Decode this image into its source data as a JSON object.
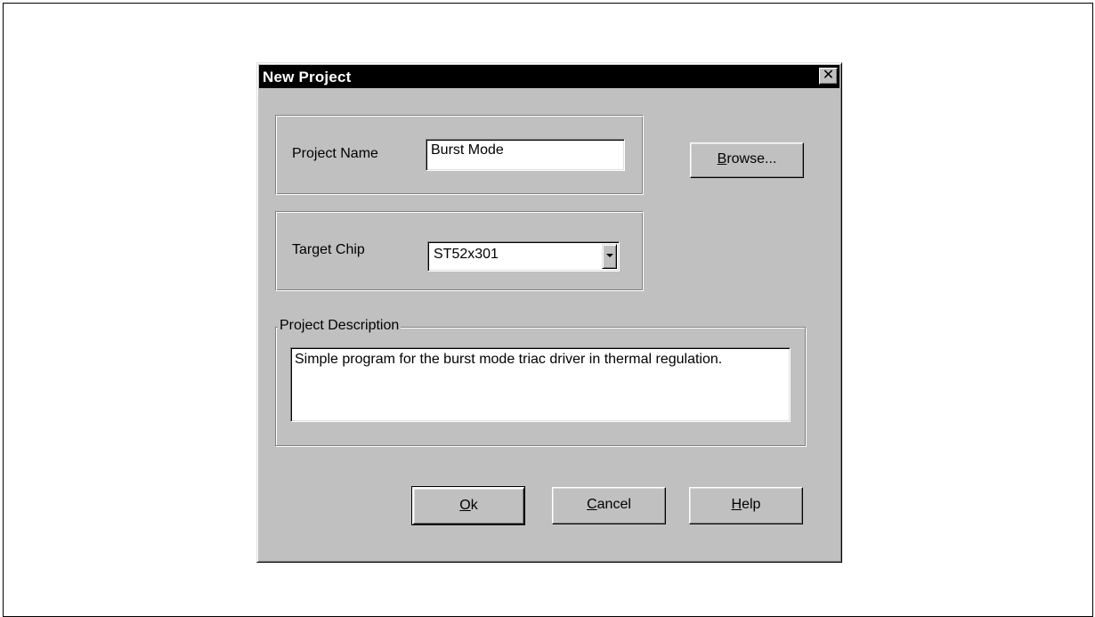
{
  "dialog": {
    "title": "New Project",
    "close_label": "✕"
  },
  "project_name": {
    "label": "Project Name",
    "value": "Burst Mode"
  },
  "browse_button": {
    "mnemonic": "B",
    "rest": "rowse..."
  },
  "target_chip": {
    "label": "Target Chip",
    "value": "ST52x301"
  },
  "description": {
    "legend": "Project Description",
    "value": "Simple program for the burst mode triac driver in thermal regulation."
  },
  "buttons": {
    "ok": {
      "mnemonic": "O",
      "rest": "k"
    },
    "cancel": {
      "mnemonic": "C",
      "rest": "ancel"
    },
    "help": {
      "mnemonic": "H",
      "rest": "elp"
    }
  },
  "colors": {
    "dialog_bg": "#c0c0c0",
    "titlebar_bg": "#000000",
    "titlebar_text": "#ffffff"
  }
}
